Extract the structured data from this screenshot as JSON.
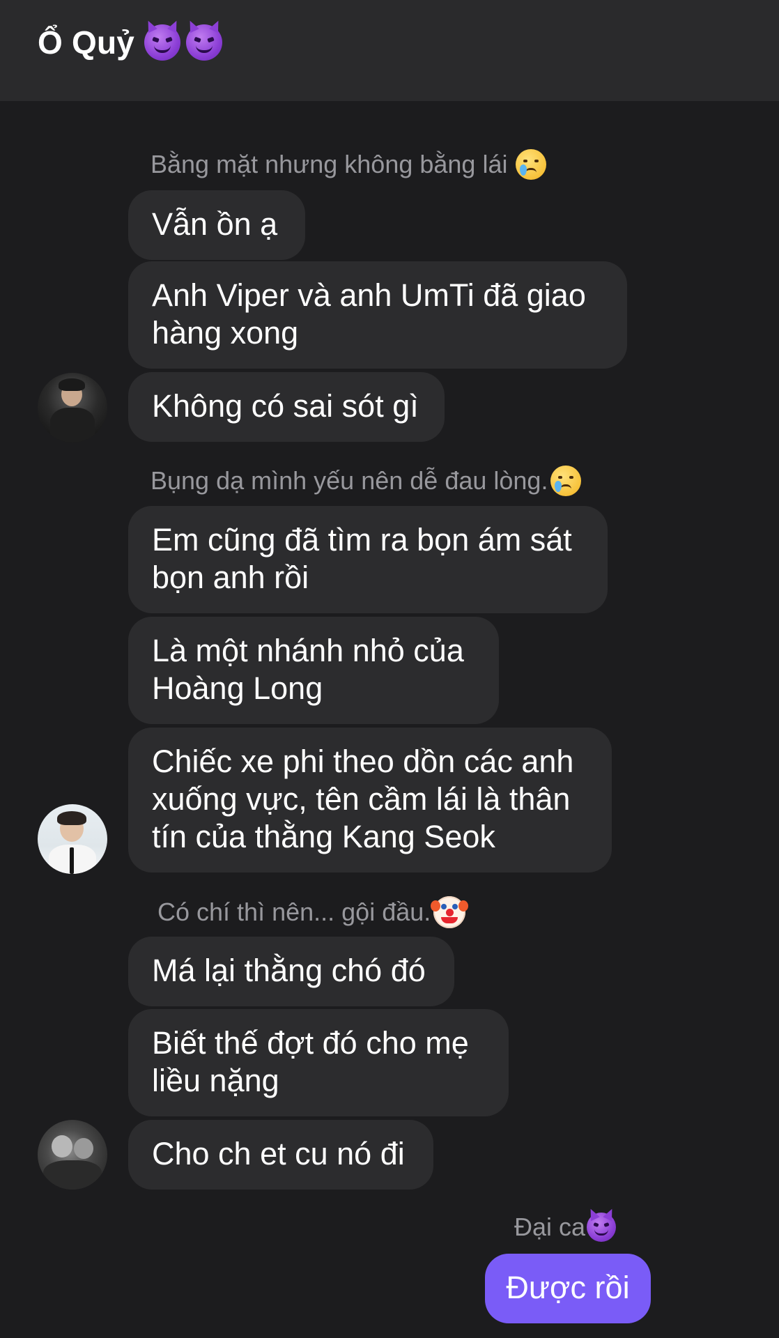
{
  "header": {
    "title": "Ổ Quỷ",
    "title_emojis": [
      "smiling-face-with-horns",
      "smiling-face-with-horns"
    ]
  },
  "groups": [
    {
      "sender": "Bằng mặt nhưng không bằng lái",
      "sender_emoji": "crying-face",
      "messages": [
        "Vẫn ồn ạ",
        "Anh Viper và  anh UmTi đã giao hàng xong",
        "Không có sai sót gì"
      ]
    },
    {
      "sender": "Bụng dạ mình yếu nên dễ đau lòng.",
      "sender_emoji": "crying-face",
      "messages": [
        "Em cũng đã tìm ra bọn ám sát bọn anh rồi",
        "Là một nhánh nhỏ của Hoàng Long",
        "Chiếc xe phi theo dồn các anh xuống vực, tên cầm lái là thân tín của thằng Kang Seok"
      ]
    },
    {
      "sender": "Có chí thì nên... gội đầu.",
      "sender_emoji": "clown-face",
      "messages": [
        "Má lại thằng chó đó",
        "Biết thế đợt đó cho mẹ liều nặng",
        "Cho ch et cu nó đi"
      ]
    }
  ],
  "me": {
    "sender": "Đại ca",
    "sender_emoji": "smiling-face-with-horns",
    "message": "Được rồi",
    "bubble_color": "#7a5cf7"
  },
  "colors": {
    "background": "#1c1c1e",
    "header": "#2a2a2c",
    "bubble": "#2c2c2e",
    "sender_text": "#98989d"
  }
}
